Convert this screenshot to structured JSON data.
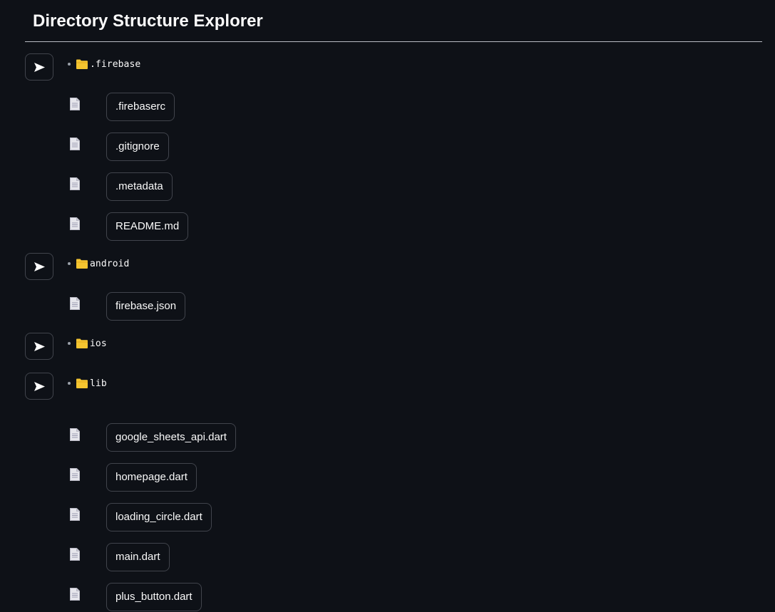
{
  "header": {
    "title": "Directory Structure Explorer"
  },
  "icons": {
    "expander": "arrow-right-icon",
    "folder": "folder-icon",
    "file": "file-icon",
    "bullet": "bullet"
  },
  "colors": {
    "background": "#0e1117",
    "text": "#fafafa",
    "border": "#41444c",
    "folder": "#f4c430"
  },
  "tree": [
    {
      "folder": ".firebase",
      "files": [
        ".firebaserc",
        ".gitignore",
        ".metadata",
        "README.md"
      ]
    },
    {
      "folder": "android",
      "files": [
        "firebase.json"
      ]
    },
    {
      "folder": "ios",
      "files": []
    },
    {
      "folder": "lib",
      "files": [
        "google_sheets_api.dart",
        "homepage.dart",
        "loading_circle.dart",
        "main.dart",
        "plus_button.dart"
      ]
    }
  ]
}
